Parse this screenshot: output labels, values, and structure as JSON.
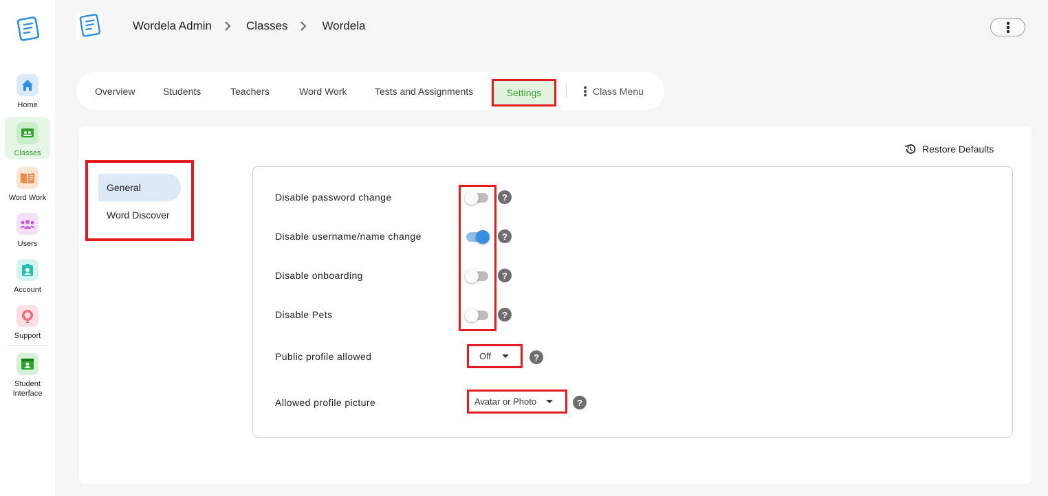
{
  "sidebar": {
    "items": [
      {
        "label": "Home",
        "icon": "home-icon",
        "color": "#2f8fe0",
        "bg": "#dbeaf8"
      },
      {
        "label": "Classes",
        "icon": "classes-icon",
        "color": "#2ea32e",
        "bg": "#c9ecc9"
      },
      {
        "label": "Word Work",
        "icon": "book-icon",
        "color": "#f08a4b",
        "bg": "#fde5d6"
      },
      {
        "label": "Users",
        "icon": "users-icon",
        "color": "#c05fd8",
        "bg": "#f4e1f9"
      },
      {
        "label": "Account",
        "icon": "account-icon",
        "color": "#2bbfb1",
        "bg": "#d5f4f1"
      },
      {
        "label": "Support",
        "icon": "support-icon",
        "color": "#f06a7e",
        "bg": "#fde0e5"
      },
      {
        "label": "Student Interface",
        "icon": "student-interface-icon",
        "color": "#2ea32e",
        "bg": "#d6f2d6"
      }
    ]
  },
  "breadcrumb": [
    "Wordela Admin",
    "Classes",
    "Wordela"
  ],
  "tabs": [
    "Overview",
    "Students",
    "Teachers",
    "Word Work",
    "Tests and Assignments",
    "Settings"
  ],
  "class_menu": "Class Menu",
  "restore_defaults": "Restore Defaults",
  "subnav": [
    "General",
    "Word Discover"
  ],
  "settings": {
    "toggles": [
      {
        "label": "Disable password change",
        "on": false
      },
      {
        "label": "Disable username/name change",
        "on": true
      },
      {
        "label": "Disable onboarding",
        "on": false
      },
      {
        "label": "Disable Pets",
        "on": false
      }
    ],
    "public_profile": {
      "label": "Public profile allowed",
      "value": "Off"
    },
    "profile_picture": {
      "label": "Allowed profile picture",
      "value": "Avatar or Photo"
    }
  },
  "colors": {
    "accent_green": "#2ea32e",
    "highlight_red": "#e21b23",
    "toggle_blue": "#3b8fe0"
  }
}
